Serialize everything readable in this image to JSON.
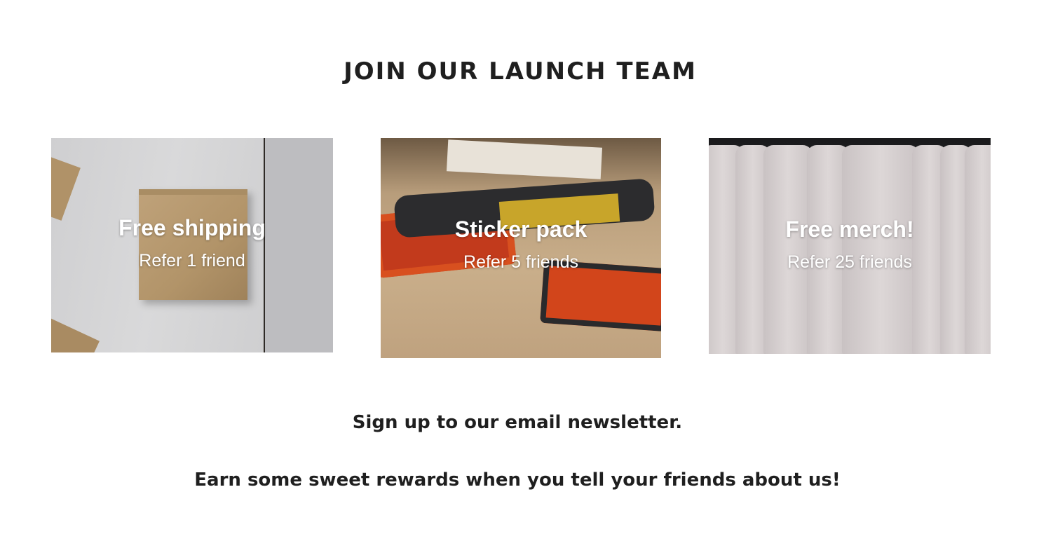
{
  "header": {
    "title": "JOIN OUR LAUNCH TEAM"
  },
  "rewards": [
    {
      "title": "Free shipping",
      "subtitle": "Refer 1 friend"
    },
    {
      "title": "Sticker pack",
      "subtitle": "Refer 5 friends"
    },
    {
      "title": "Free merch!",
      "subtitle": "Refer 25 friends"
    }
  ],
  "footer": {
    "signup_text": "Sign up to our email newsletter.",
    "rewards_text": "Earn some sweet rewards when you tell your friends about us!"
  }
}
